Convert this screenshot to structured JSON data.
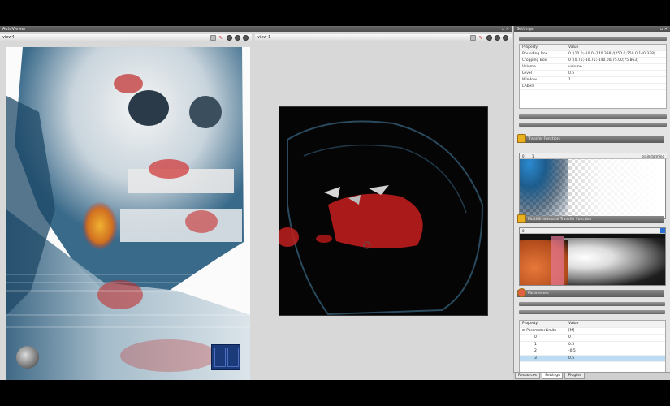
{
  "window": {
    "title": "AutoViewer",
    "controls": "▫ ✕"
  },
  "viewer_left": {
    "title": "view4"
  },
  "viewer_right": {
    "title": "view 1"
  },
  "settings": {
    "title": "Settings",
    "controls": "▫ ✕",
    "grid_headers": {
      "key": "Property",
      "value": "Value"
    },
    "rows": [
      {
        "k": "Bounding Box",
        "v": "0 :(10.0;-10.0;-140.338)/(250.0;250.0;140.338)"
      },
      {
        "k": "Cropping Box",
        "v": "0 :(0.75;-10.75;-140.00/75.00;75.863)"
      },
      {
        "k": "Volume",
        "v": "volume"
      },
      {
        "k": "Level",
        "v": "0.5"
      },
      {
        "k": "Window",
        "v": "1"
      },
      {
        "k": "LAbels",
        "v": ""
      }
    ]
  },
  "panel_tf1": {
    "label": "Transfer Function",
    "val0": "0",
    "val1": "1",
    "right": "brainstorming"
  },
  "panel_tf2": {
    "label": "Multidimensional Transfer Function",
    "val0": "0"
  },
  "panel_params": {
    "label": "Parameters",
    "grid_headers": {
      "key": "Property",
      "value": "Value"
    },
    "rows": [
      {
        "k": "⊟ ParameterLimits",
        "v": "[M]"
      },
      {
        "k": "0",
        "v": "0"
      },
      {
        "k": "1",
        "v": "0.5"
      },
      {
        "k": "2",
        "v": "-0.5"
      },
      {
        "k": "3",
        "v": "0.5"
      }
    ]
  },
  "tabs": [
    "Resources",
    "Settings",
    "Plugins"
  ]
}
